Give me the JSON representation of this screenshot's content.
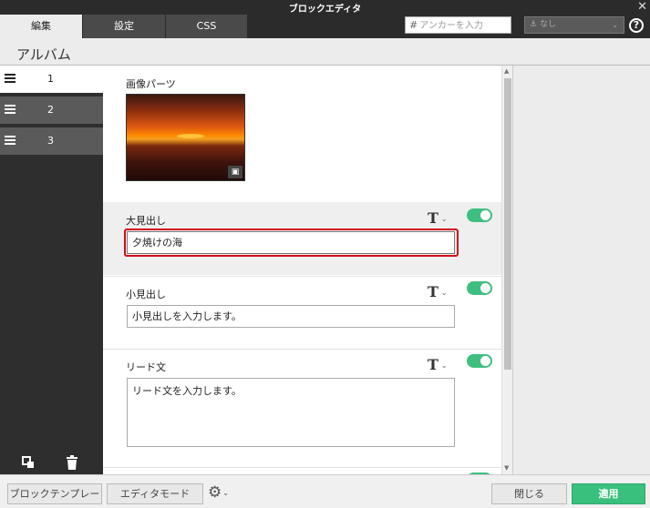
{
  "window": {
    "title": "ブロックエディタ",
    "close_glyph": "✕"
  },
  "tabs": [
    {
      "label": "編集",
      "active": true
    },
    {
      "label": "設定",
      "active": false
    },
    {
      "label": "CSS",
      "active": false
    }
  ],
  "anchor": {
    "hash": "#",
    "placeholder": "アンカーを入力"
  },
  "anchor_select": {
    "icon": "anchor-icon",
    "value": "なし"
  },
  "help_icon": "?",
  "header": {
    "title": "アルバム"
  },
  "sidebar": {
    "items": [
      {
        "label": "1",
        "active": true
      },
      {
        "label": "2",
        "active": false
      },
      {
        "label": "3",
        "active": false
      }
    ],
    "bottom_icons": [
      "duplicate-icon",
      "trash-icon"
    ]
  },
  "blocks": {
    "image": {
      "label": "画像パーツ",
      "badge_icon": "image-icon"
    },
    "heading_large": {
      "label": "大見出し",
      "value": "夕焼けの海",
      "toggle_on": true
    },
    "heading_small": {
      "label": "小見出し",
      "placeholder": "小見出しを入力します。",
      "toggle_on": true
    },
    "lead": {
      "label": "リード文",
      "placeholder": "リード文を入力します。",
      "toggle_on": true
    },
    "text_format_glyph": "T"
  },
  "footer": {
    "block_template": "ブロックテンプレート",
    "editor_mode": "エディタモード",
    "close": "閉じる",
    "apply": "適用"
  },
  "colors": {
    "accent_green": "#39c07c",
    "focus_red": "#d10f16",
    "dark_bg": "#2b2b2b"
  }
}
